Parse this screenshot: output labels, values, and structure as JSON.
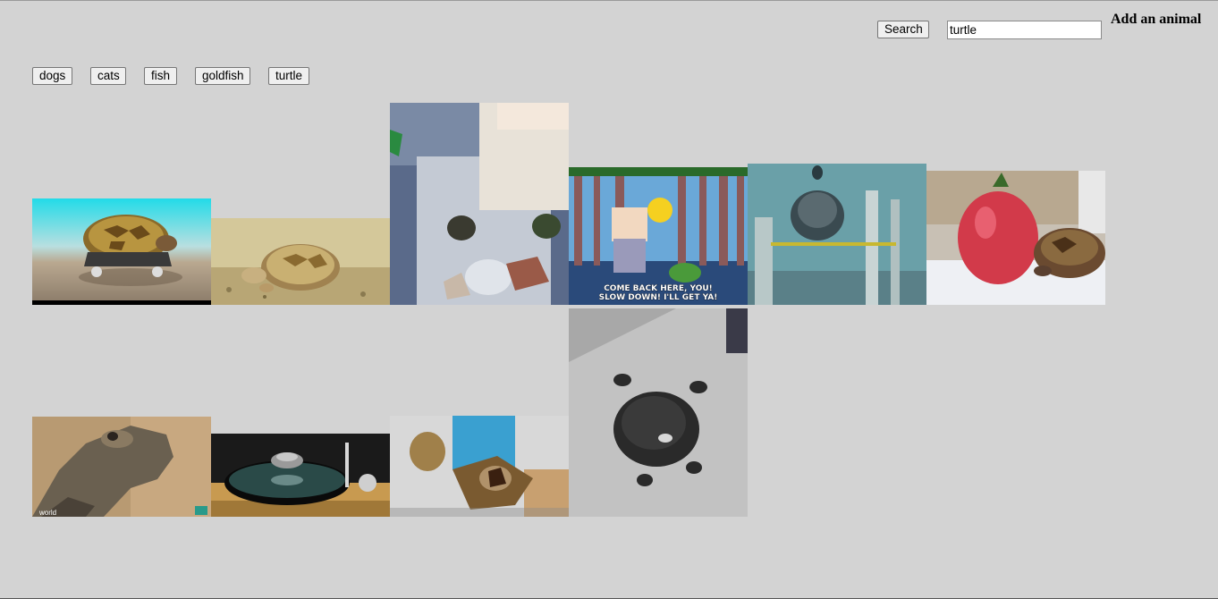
{
  "search": {
    "button_label": "Search",
    "query": "turtle"
  },
  "add_animal": {
    "label": "Add an animal"
  },
  "category_buttons": [
    {
      "label": "dogs"
    },
    {
      "label": "cats"
    },
    {
      "label": "fish"
    },
    {
      "label": "goldfish"
    },
    {
      "label": "turtle"
    }
  ],
  "gifs": [
    {
      "subject": "tortoise on skateboard",
      "overlay_text": ""
    },
    {
      "subject": "baby tortoise on sand",
      "overlay_text": ""
    },
    {
      "subject": "baby turtles in tank",
      "overlay_text": ""
    },
    {
      "subject": "grampa simpson chasing turtle",
      "overlay_text": "COME BACK HERE, YOU! SLOW DOWN! I'LL GET YA!"
    },
    {
      "subject": "turtle on perch",
      "overlay_text": ""
    },
    {
      "subject": "tortoise beside tomato",
      "overlay_text": ""
    },
    {
      "subject": "giant tortoise head",
      "overlay_text": "world"
    },
    {
      "subject": "turtle on record player",
      "overlay_text": ""
    },
    {
      "subject": "snapping turtle held up",
      "overlay_text": ""
    },
    {
      "subject": "turtle spinning on back",
      "overlay_text": ""
    }
  ]
}
